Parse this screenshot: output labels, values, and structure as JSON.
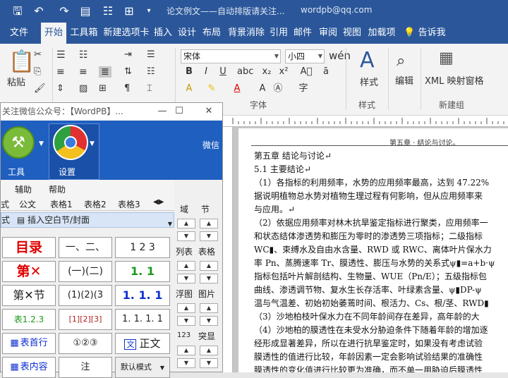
{
  "title_bar": {
    "doc_title": "论文例文——自动排版请关注...",
    "user": "wordpb@qq.com"
  },
  "ribbon_tabs": [
    "文件",
    "开始",
    "工具箱",
    "新建选项卡",
    "插入",
    "设计",
    "布局",
    "背景消除",
    "引用",
    "邮件",
    "审阅",
    "视图",
    "加载项"
  ],
  "tell_me": "告诉我",
  "share": "共享",
  "ribbon": {
    "paste": "粘贴",
    "font_name": "宋体",
    "font_size": "小四",
    "styles": "样式",
    "edit": "编辑",
    "xml": "XML 映射窗格",
    "group_font": "字体",
    "group_style": "样式",
    "group_new": "新建组"
  },
  "panel": {
    "title": "关注微信公众号：【WordPB】...",
    "tool_tools": "工具",
    "tool_settings": "设置",
    "tool_wechat": "微信",
    "tabs_row1": [
      "辅助",
      "帮助"
    ],
    "tabs_row2": [
      "式",
      "公文",
      "表格1",
      "表格2",
      "表格3"
    ],
    "insert_label": "插入空白节/封面",
    "insert_prefix": "式",
    "side_labels": [
      "域",
      "节",
      "列表",
      "表格",
      "浮图",
      "图片",
      "123",
      "突显"
    ],
    "mode": "默认模式",
    "cells": [
      [
        "目录",
        "一、二、",
        "1 2 3"
      ],
      [
        "第✕",
        "(一)(二)",
        "1. 1"
      ],
      [
        "第✕节",
        "(1)(2)(3",
        "1. 1. 1"
      ],
      [
        "表1.2.3",
        "[1][2][3]",
        "1. 1. 1. 1"
      ],
      [
        "表首行",
        "①②③",
        "正文"
      ],
      [
        "表内容",
        "注",
        ""
      ]
    ]
  },
  "document": {
    "header": "第五章 · 结论与讨论。",
    "lines": [
      "第五章  结论与讨论↵",
      "5.1  主要结论↵",
      "（1）各指标的利用频率，水势的应用频率最高，达到 47.22%",
      "据说明植物总水势对植物生理过程有何影响，但从应用频率来",
      "与应用。↵",
      "（2）依据应用频率对林木抗旱鉴定指标进行聚类，应用频率一",
      "和状态结体渗透势和膨压为零时的渗透势三项指标；二级指标",
      "WC▮、束缚水及自由水含量、RWD 或 RWC、离体叶片保水力",
      "率 Pn、蒸腾速率 Tr、膜透性、膨压与水势的关系式ψ▮=a+b·ψ",
      "指标包括叶片解剖结构、生物量、WUE（Pn/E）；五级指标包",
      "曲线、渗透调节物、复水生长存活率、叶绿素含量、ψ▮DP-ψ",
      "温与气温差、初始初始萎蔫时间、根活力、Cs、根/茎、RWD▮",
      "（3）沙地柏枝叶保水力在不同年龄间存在差异，高年龄的大",
      "（4）沙地柏的膜透性在未受水分胁迫条件下随着年龄的增加逐",
      "经形成显著差异，所以在进行抗旱鉴定时，如果没有考虑试验",
      "膜透性的值进行比较，年龄因素一定会影响试验结果的准确性",
      "膜透性的变化值进行比较更为准确，而不单一用胁迫后膜透性",
      "（5）水分运移是鉴别抗旱性强弱的一个重要指标，一般来讲，"
    ]
  },
  "colors": {
    "word_blue": "#2b579a",
    "panel_blue": "#1f5fbf",
    "red": "#e00000",
    "green": "#1a9a1a",
    "blue": "#1030d0"
  }
}
